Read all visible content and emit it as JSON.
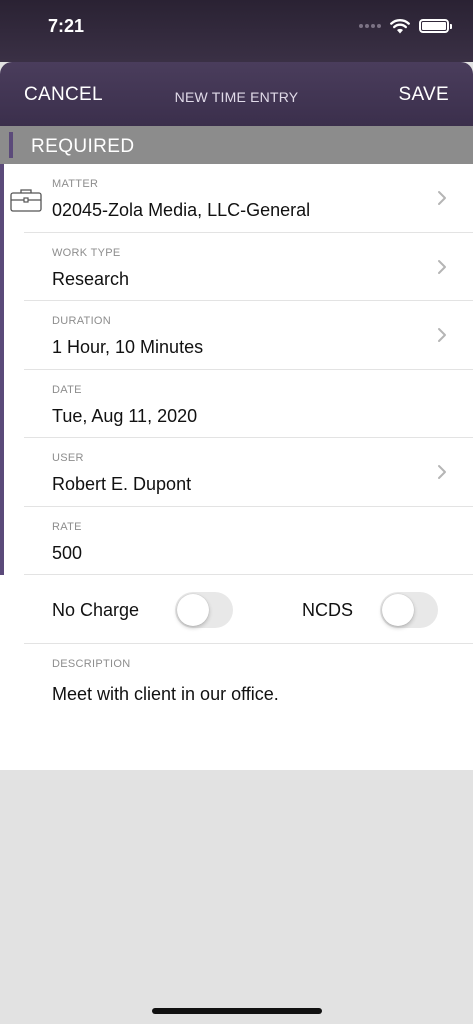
{
  "status_bar": {
    "time": "7:21"
  },
  "nav": {
    "cancel_label": "CANCEL",
    "title": "NEW TIME ENTRY",
    "save_label": "SAVE"
  },
  "section": {
    "label": "REQUIRED"
  },
  "fields": [
    {
      "label": "MATTER",
      "value": "02045-Zola Media, LLC-General"
    },
    {
      "label": "WORK TYPE",
      "value": "Research"
    },
    {
      "label": "DURATION",
      "value": "1 Hour, 10 Minutes"
    },
    {
      "label": "DATE",
      "value": "Tue, Aug 11, 2020"
    },
    {
      "label": "USER",
      "value": "Robert E. Dupont"
    },
    {
      "label": "RATE",
      "value": "500"
    }
  ],
  "toggles": {
    "no_charge": {
      "label": "No Charge",
      "on": false
    },
    "ncds": {
      "label": "NCDS",
      "on": false
    }
  },
  "description": {
    "label": "DESCRIPTION",
    "value": "Meet with client in our office."
  },
  "colors": {
    "header": "#3b2f4c",
    "accent": "#5b4a7a",
    "section_gray": "#8c8c8c"
  }
}
